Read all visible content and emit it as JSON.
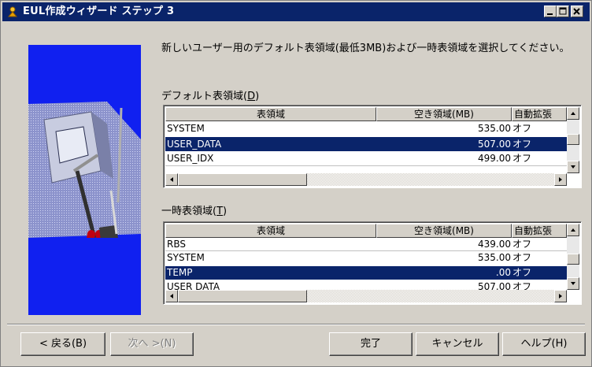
{
  "window": {
    "title": "EUL作成ウィザード ステップ 3",
    "controls": [
      "minimize-icon",
      "maximize-icon",
      "close-icon"
    ]
  },
  "instruction": "新しいユーザー用のデフォルト表領域(最低3MB)および一時表領域を選択してください。",
  "default_tablespace": {
    "label": "デフォルト表領域(D)",
    "columns": [
      "表領域",
      "空き領域(MB)",
      "自動拡張"
    ],
    "rows": [
      {
        "name": "SYSTEM",
        "free": "535.00",
        "auto": "オフ",
        "selected": false
      },
      {
        "name": "USER_DATA",
        "free": "507.00",
        "auto": "オフ",
        "selected": true
      },
      {
        "name": "USER_IDX",
        "free": "499.00",
        "auto": "オフ",
        "selected": false
      }
    ]
  },
  "temp_tablespace": {
    "label": "一時表領域(T)",
    "columns": [
      "表領域",
      "空き領域(MB)",
      "自動拡張"
    ],
    "rows": [
      {
        "name": "RBS",
        "free": "439.00",
        "auto": "オフ",
        "selected": false
      },
      {
        "name": "SYSTEM",
        "free": "535.00",
        "auto": "オフ",
        "selected": false
      },
      {
        "name": "TEMP",
        "free": ".00",
        "auto": "オフ",
        "selected": true
      },
      {
        "name": "USER DATA",
        "free": "507.00",
        "auto": "オフ",
        "selected": false
      }
    ]
  },
  "buttons": {
    "back": "< 戻る(B)",
    "next": "次へ >(N)",
    "finish": "完了",
    "cancel": "キャンセル",
    "help": "ヘルプ(H)"
  },
  "colors": {
    "face": "#d4d0c8",
    "titlebar": "#0a246a",
    "selection": "#0a246a",
    "art_background": "#1020f0"
  }
}
